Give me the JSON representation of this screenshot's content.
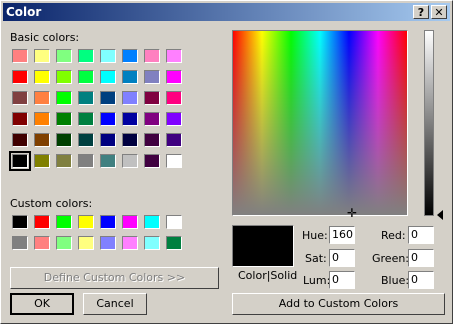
{
  "window": {
    "title": "Color",
    "help": "?",
    "close": "✕"
  },
  "basic_colors_label": "Basic colors:",
  "custom_colors_label": "Custom colors:",
  "basic_colors": [
    "#ff8080",
    "#ffff80",
    "#80ff80",
    "#00ff80",
    "#80ffff",
    "#0080ff",
    "#ff80c0",
    "#ff80ff",
    "#ff0000",
    "#ffff00",
    "#80ff00",
    "#00ff40",
    "#00ffff",
    "#0080c0",
    "#8080c0",
    "#ff00ff",
    "#804040",
    "#ff8040",
    "#00ff00",
    "#008080",
    "#004080",
    "#8080ff",
    "#800040",
    "#ff0080",
    "#800000",
    "#ff8000",
    "#008000",
    "#008040",
    "#0000ff",
    "#0000a0",
    "#800080",
    "#8000ff",
    "#400000",
    "#804000",
    "#004000",
    "#004040",
    "#000080",
    "#000040",
    "#400040",
    "#400080",
    "#000000",
    "#808000",
    "#808040",
    "#808080",
    "#408080",
    "#c0c0c0",
    "#400040",
    "#ffffff"
  ],
  "selected_basic_index": 40,
  "custom_colors": [
    "#000000",
    "#ff0000",
    "#00ff00",
    "#ffff00",
    "#0000ff",
    "#ff00ff",
    "#00ffff",
    "#ffffff",
    "#808080",
    "#ff8080",
    "#80ff80",
    "#ffff80",
    "#8080ff",
    "#ff80ff",
    "#80ffff",
    "#008040"
  ],
  "buttons": {
    "define_custom": "Define Custom Colors >>",
    "ok": "OK",
    "cancel": "Cancel",
    "add_custom": "Add to Custom Colors"
  },
  "preview_label": "Color|Solid",
  "fields": {
    "hue": {
      "label": "Hue:",
      "value": "160"
    },
    "sat": {
      "label": "Sat:",
      "value": "0"
    },
    "lum": {
      "label": "Lum:",
      "value": "0"
    },
    "red": {
      "label": "Red:",
      "value": "0"
    },
    "green": {
      "label": "Green:",
      "value": "0"
    },
    "blue": {
      "label": "Blue:",
      "value": "0"
    }
  }
}
